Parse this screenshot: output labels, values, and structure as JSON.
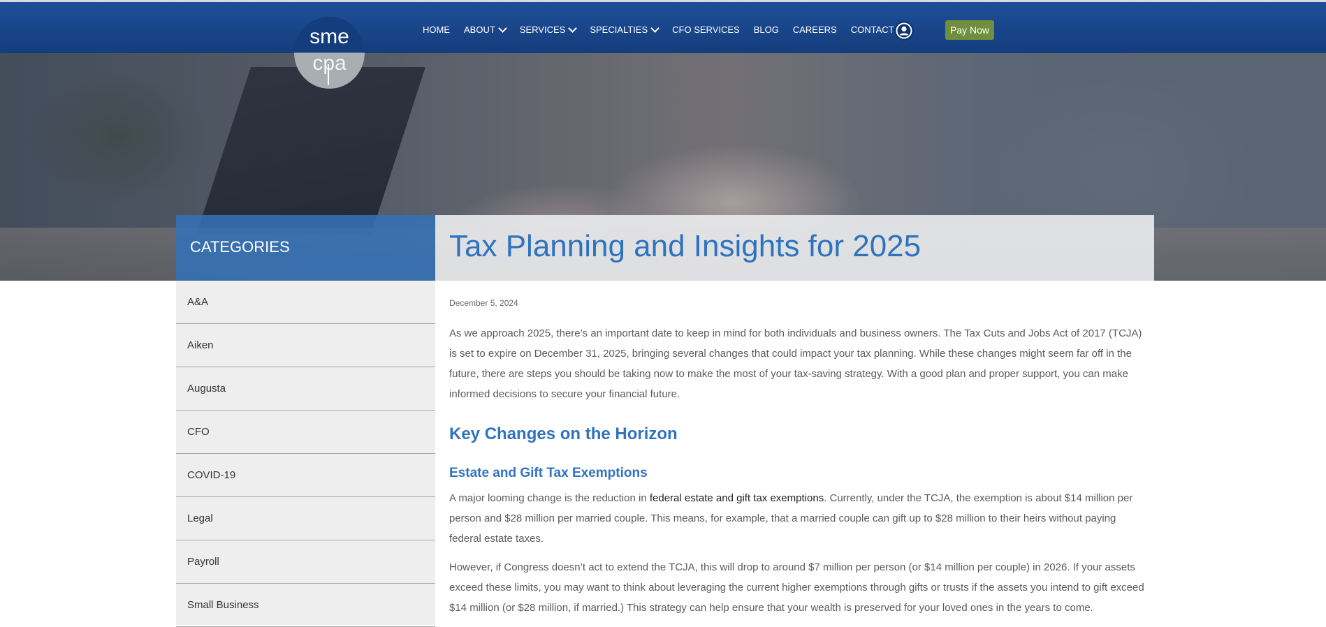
{
  "brand": {
    "logo_top": "sme",
    "logo_bottom": "cpa"
  },
  "nav": {
    "items": [
      {
        "label": "HOME",
        "dropdown": false
      },
      {
        "label": "ABOUT",
        "dropdown": true
      },
      {
        "label": "SERVICES",
        "dropdown": true
      },
      {
        "label": "SPECIALTIES",
        "dropdown": true
      },
      {
        "label": "CFO SERVICES",
        "dropdown": false
      },
      {
        "label": "BLOG",
        "dropdown": false
      },
      {
        "label": "CAREERS",
        "dropdown": false
      },
      {
        "label": "CONTACT",
        "dropdown": false
      }
    ],
    "user_icon": "user-circle-icon",
    "pay_button": "Pay Now"
  },
  "colors": {
    "header": "#1f4f98",
    "accent": "#2f73bf",
    "pay_button": "#6f8f3e",
    "sidebar_bg": "#eeeeee"
  },
  "sidebar": {
    "heading": "CATEGORIES",
    "items": [
      "A&A",
      "Aiken",
      "Augusta",
      "CFO",
      "COVID-19",
      "Legal",
      "Payroll",
      "Small Business"
    ]
  },
  "article": {
    "title": "Tax Planning and Insights for 2025",
    "date": "December 5, 2024",
    "intro": "As we approach 2025, there’s an important date to keep in mind for both individuals and business owners. The Tax Cuts and Jobs Act of 2017 (TCJA) is set to expire on December 31, 2025, bringing several changes that could impact your tax planning. While these changes might seem far off in the future, there are steps you should be taking now to make the most of your tax-saving strategy. With a good plan and proper support, you can make informed decisions to secure your financial future.",
    "h2": "Key Changes on the Horizon",
    "h3": "Estate and Gift Tax Exemptions",
    "p2_before": "A major looming change is the reduction in ",
    "p2_link": "federal estate and gift tax exemptions",
    "p2_after": ". Currently, under the TCJA, the exemption is about $14 million per person and $28 million per married couple. This means, for example, that a married couple can gift up to $28 million to their heirs without paying federal estate taxes.",
    "p3": "However, if Congress doesn’t act to extend the TCJA, this will drop to around $7 million per person (or $14 million per couple) in 2026. If your assets exceed these limits, you may want to think about leveraging the current higher exemptions through gifts or trusts if the assets you intend to gift exceed $14 million (or $28 million, if married.) This strategy can help ensure that your wealth is preserved for your loved ones in the years to come."
  }
}
